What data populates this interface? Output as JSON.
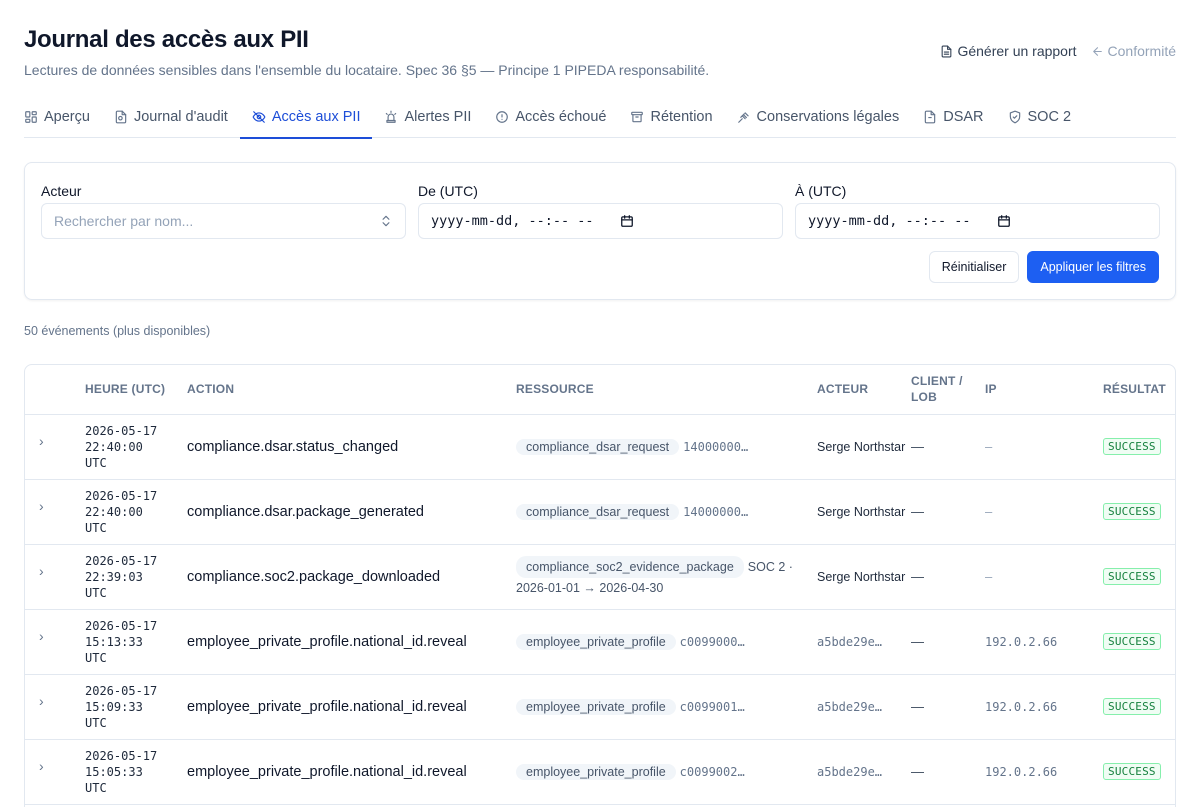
{
  "header": {
    "title": "Journal des accès aux PII",
    "subtitle": "Lectures de données sensibles dans l'ensemble du locataire. Spec 36 §5 — Principe 1 PIPEDA responsabilité.",
    "report_label": "Générer un rapport",
    "back_label": "Conformité"
  },
  "tabs": [
    {
      "label": "Aperçu",
      "icon": "grid-icon"
    },
    {
      "label": "Journal d'audit",
      "icon": "file-audit-icon"
    },
    {
      "label": "Accès aux PII",
      "icon": "eye-off-icon"
    },
    {
      "label": "Alertes PII",
      "icon": "siren-icon"
    },
    {
      "label": "Accès échoué",
      "icon": "alert-circle-icon"
    },
    {
      "label": "Rétention",
      "icon": "archive-icon"
    },
    {
      "label": "Conservations légales",
      "icon": "gavel-icon"
    },
    {
      "label": "DSAR",
      "icon": "file-icon"
    },
    {
      "label": "SOC 2",
      "icon": "shield-check-icon"
    }
  ],
  "filters": {
    "actor_label": "Acteur",
    "actor_placeholder": "Rechercher par nom...",
    "from_label": "De (UTC)",
    "from_value": "yyyy-mm-dd, --:-- --",
    "to_label": "À (UTC)",
    "to_value": "yyyy-mm-dd, --:-- --",
    "reset_label": "Réinitialiser",
    "apply_label": "Appliquer les filtres"
  },
  "count_text": "50 événements (plus disponibles)",
  "table": {
    "columns": {
      "time": "Heure (UTC)",
      "action": "Action",
      "resource": "Ressource",
      "actor": "Acteur",
      "client": "Client / LOB",
      "ip": "IP",
      "result": "Résultat"
    },
    "rows": [
      {
        "date": "2026-05-17",
        "clock": "22:40:00",
        "tz": "UTC",
        "action": "compliance.dsar.status_changed",
        "resource_type": "compliance_dsar_request",
        "resource_id": "14000000…",
        "actor": "Serge Northstar",
        "client": "—",
        "ip": "—",
        "result": "SUCCESS"
      },
      {
        "date": "2026-05-17",
        "clock": "22:40:00",
        "tz": "UTC",
        "action": "compliance.dsar.package_generated",
        "resource_type": "compliance_dsar_request",
        "resource_id": "14000000…",
        "actor": "Serge Northstar",
        "client": "—",
        "ip": "—",
        "result": "SUCCESS"
      },
      {
        "date": "2026-05-17",
        "clock": "22:39:03",
        "tz": "UTC",
        "action": "compliance.soc2.package_downloaded",
        "resource_type": "compliance_soc2_evidence_package",
        "resource_id": "SOC 2 · 2026-01-01 → 2026-04-30",
        "actor": "Serge Northstar",
        "client": "—",
        "ip": "—",
        "result": "SUCCESS"
      },
      {
        "date": "2026-05-17",
        "clock": "15:13:33",
        "tz": "UTC",
        "action": "employee_private_profile.national_id.reveal",
        "resource_type": "employee_private_profile",
        "resource_id": "c0099000…",
        "actor": "a5bde29e…",
        "client": "—",
        "ip": "192.0.2.66",
        "result": "SUCCESS"
      },
      {
        "date": "2026-05-17",
        "clock": "15:09:33",
        "tz": "UTC",
        "action": "employee_private_profile.national_id.reveal",
        "resource_type": "employee_private_profile",
        "resource_id": "c0099001…",
        "actor": "a5bde29e…",
        "client": "—",
        "ip": "192.0.2.66",
        "result": "SUCCESS"
      },
      {
        "date": "2026-05-17",
        "clock": "15:05:33",
        "tz": "UTC",
        "action": "employee_private_profile.national_id.reveal",
        "resource_type": "employee_private_profile",
        "resource_id": "c0099002…",
        "actor": "a5bde29e…",
        "client": "—",
        "ip": "192.0.2.66",
        "result": "SUCCESS"
      }
    ]
  }
}
